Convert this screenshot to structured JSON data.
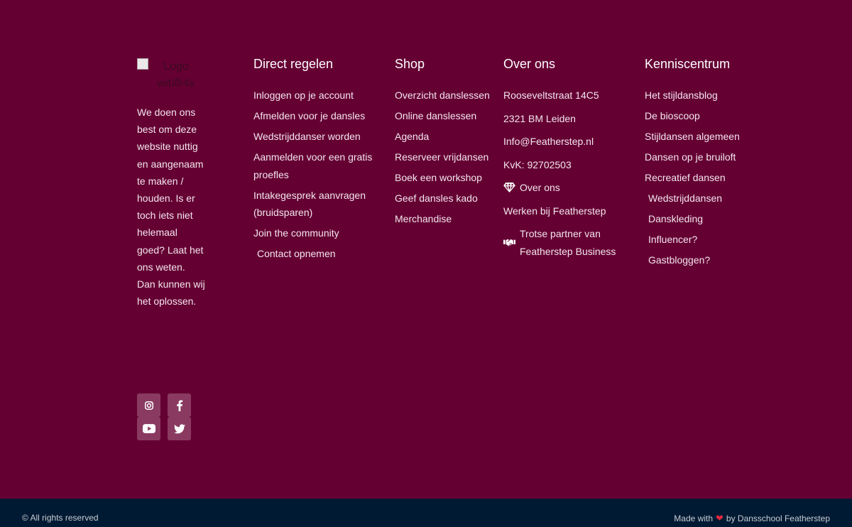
{
  "logo": {
    "alt": "Logo wit@4x"
  },
  "about": {
    "text": "We doen ons best om deze website nuttig en aangenaam te maken / houden. Is er toch iets niet helemaal goed? Laat het ons weten. Dan kunnen wij het oplossen."
  },
  "social": [
    "instagram-icon",
    "facebook-icon",
    "youtube-icon",
    "twitter-icon"
  ],
  "columns": {
    "direct": {
      "title": "Direct regelen",
      "items": [
        "Inloggen op je account",
        "Afmelden voor je dansles",
        "Wedstrijddanser worden",
        "Aanmelden voor een gratis proefles",
        "Intakegesprek aanvragen (bruidsparen)",
        "Join the community",
        "Contact opnemen"
      ]
    },
    "shop": {
      "title": "Shop",
      "items": [
        "Overzicht danslessen",
        "Online danslessen",
        "Agenda",
        "Reserveer vrijdansen",
        "Boek een workshop",
        "Geef dansles kado",
        "Merchandise"
      ]
    },
    "over": {
      "title": "Over ons",
      "items": [
        "Rooseveltstraat 14C5",
        "2321 BM Leiden",
        "Info@Featherstep.nl",
        "KvK: 92702503",
        "Over ons",
        "Werken bij Featherstep",
        "Trotse partner van Featherstep Business"
      ]
    },
    "kennis": {
      "title": "Kenniscentrum",
      "items": [
        "Het stijldansblog",
        "De bioscoop",
        "Stijldansen algemeen",
        "Dansen op je bruiloft",
        "Recreatief dansen",
        "Wedstrijddansen",
        "Danskleding",
        "Influencer?",
        "Gastbloggen?"
      ]
    }
  },
  "bottom": {
    "copyright": "© All rights reserved",
    "made_prefix": "Made with",
    "made_suffix": "by Dansschool Featherstep"
  },
  "colors": {
    "footer_bg": "#650033",
    "bottom_bg": "#001a33",
    "heart": "#e2283d"
  }
}
